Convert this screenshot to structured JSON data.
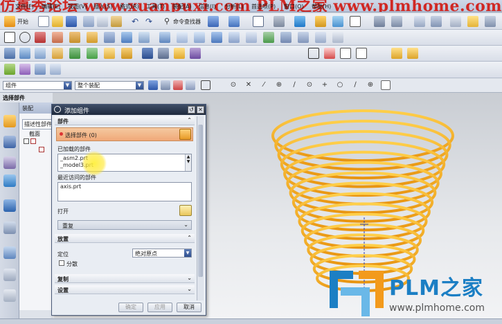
{
  "menubar": {
    "watermark": "仿真秀论坛  www.xuanpuxi.com  PLM之家  www.plmhome.com  四叶",
    "items": [
      "文件(F)",
      "编辑(E)",
      "视图(V)",
      "插入(S)",
      "格式(R)",
      "工具(T)",
      "装配(A)",
      "信息(I)",
      "分析(L)",
      "首选项(P)",
      "窗口(O)",
      "帮助(H)"
    ]
  },
  "toolbar1": {
    "start_label": "开始",
    "cmd_finder_label": "命令查找器"
  },
  "selection_bar": {
    "filter_value": "组件",
    "scope_value": "整个装配"
  },
  "panel": {
    "section_label": "选择部件",
    "nav_title": "装配",
    "nav_rows": [
      "描述性部件",
      "截面",
      "",
      ""
    ]
  },
  "dialog": {
    "title": "添加组件",
    "part_group": "部件",
    "select_part": "选择部件 (0)",
    "loaded_parts_label": "已加载的部件",
    "loaded_parts": [
      "_asm2.prt",
      "_model3.prt"
    ],
    "recent_parts_label": "最近访问的部件",
    "recent_parts": [
      "axis.prt"
    ],
    "open_label": "打开",
    "repeat_label": "重复",
    "placement_group": "放置",
    "position_label": "定位",
    "position_value": "绝对原点",
    "scatter_label": "分散",
    "copy_group": "复制",
    "settings_group": "设置",
    "ok_label": "确定",
    "apply_label": "应用",
    "cancel_label": "取消"
  },
  "brand": {
    "name": "PLM之家",
    "url": "www.plmhome.com"
  },
  "colors": {
    "spring": "#f2a81d",
    "brand_blue": "#1c7fc4",
    "brand_orange": "#f39a1c",
    "dialog_title": "#2a364c"
  }
}
